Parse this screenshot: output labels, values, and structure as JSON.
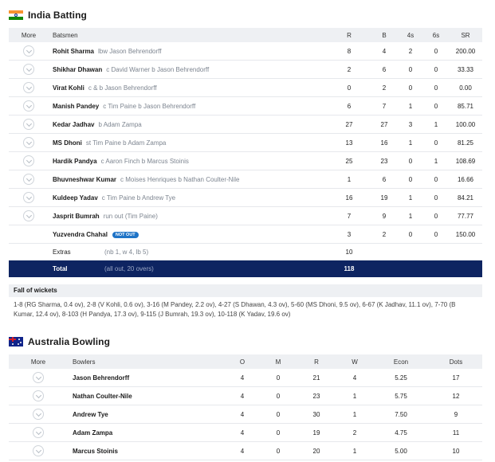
{
  "india": {
    "team_name": "India Batting",
    "headers": {
      "more": "More",
      "batsmen": "Batsmen",
      "r": "R",
      "b": "B",
      "fours": "4s",
      "sixes": "6s",
      "sr": "SR"
    },
    "rows": [
      {
        "name": "Rohit Sharma",
        "dismissal": "lbw Jason Behrendorff",
        "r": "8",
        "b": "4",
        "fours": "2",
        "sixes": "0",
        "sr": "200.00"
      },
      {
        "name": "Shikhar Dhawan",
        "dismissal": "c David Warner b Jason Behrendorff",
        "r": "2",
        "b": "6",
        "fours": "0",
        "sixes": "0",
        "sr": "33.33"
      },
      {
        "name": "Virat Kohli",
        "dismissal": "c & b Jason Behrendorff",
        "r": "0",
        "b": "2",
        "fours": "0",
        "sixes": "0",
        "sr": "0.00"
      },
      {
        "name": "Manish Pandey",
        "dismissal": "c Tim Paine b Jason Behrendorff",
        "r": "6",
        "b": "7",
        "fours": "1",
        "sixes": "0",
        "sr": "85.71"
      },
      {
        "name": "Kedar Jadhav",
        "dismissal": "b Adam Zampa",
        "r": "27",
        "b": "27",
        "fours": "3",
        "sixes": "1",
        "sr": "100.00"
      },
      {
        "name": "MS Dhoni",
        "dismissal": "st Tim Paine b Adam Zampa",
        "r": "13",
        "b": "16",
        "fours": "1",
        "sixes": "0",
        "sr": "81.25"
      },
      {
        "name": "Hardik Pandya",
        "dismissal": "c Aaron Finch b Marcus Stoinis",
        "r": "25",
        "b": "23",
        "fours": "0",
        "sixes": "1",
        "sr": "108.69"
      },
      {
        "name": "Bhuvneshwar Kumar",
        "dismissal": "c Moises Henriques b Nathan Coulter-Nile",
        "r": "1",
        "b": "6",
        "fours": "0",
        "sixes": "0",
        "sr": "16.66"
      },
      {
        "name": "Kuldeep Yadav",
        "dismissal": "c Tim Paine b Andrew Tye",
        "r": "16",
        "b": "19",
        "fours": "1",
        "sixes": "0",
        "sr": "84.21"
      },
      {
        "name": "Jasprit Bumrah",
        "dismissal": "run out (Tim Paine)",
        "r": "7",
        "b": "9",
        "fours": "1",
        "sixes": "0",
        "sr": "77.77"
      }
    ],
    "notout_row": {
      "name": "Yuzvendra Chahal",
      "badge": "NOT OUT",
      "r": "3",
      "b": "2",
      "fours": "0",
      "sixes": "0",
      "sr": "150.00"
    },
    "extras": {
      "label": "Extras",
      "detail": "(nb 1, w 4, lb 5)",
      "value": "10"
    },
    "total": {
      "label": "Total",
      "detail": "(all out, 20 overs)",
      "value": "118"
    },
    "colors": {
      "total_bg": "#0e2461",
      "badge_bg": "#1f74c7",
      "header_bg": "#eef0f3"
    }
  },
  "fall_of_wickets": {
    "title": "Fall of wickets",
    "text": "1-8 (RG Sharma, 0.4 ov), 2-8 (V Kohli, 0.6 ov), 3-16 (M Pandey, 2.2 ov), 4-27 (S Dhawan, 4.3 ov), 5-60 (MS Dhoni, 9.5 ov), 6-67 (K Jadhav, 11.1 ov), 7-70 (B Kumar, 12.4 ov), 8-103 (H Pandya, 17.3 ov), 9-115 (J Bumrah, 19.3 ov), 10-118 (K Yadav, 19.6 ov)"
  },
  "australia": {
    "team_name": "Australia Bowling",
    "headers": {
      "more": "More",
      "bowlers": "Bowlers",
      "o": "O",
      "m": "M",
      "r": "R",
      "w": "W",
      "econ": "Econ",
      "dots": "Dots"
    },
    "rows": [
      {
        "name": "Jason Behrendorff",
        "o": "4",
        "m": "0",
        "r": "21",
        "w": "4",
        "econ": "5.25",
        "dots": "17"
      },
      {
        "name": "Nathan Coulter-Nile",
        "o": "4",
        "m": "0",
        "r": "23",
        "w": "1",
        "econ": "5.75",
        "dots": "12"
      },
      {
        "name": "Andrew Tye",
        "o": "4",
        "m": "0",
        "r": "30",
        "w": "1",
        "econ": "7.50",
        "dots": "9"
      },
      {
        "name": "Adam Zampa",
        "o": "4",
        "m": "0",
        "r": "19",
        "w": "2",
        "econ": "4.75",
        "dots": "11"
      },
      {
        "name": "Marcus Stoinis",
        "o": "4",
        "m": "0",
        "r": "20",
        "w": "1",
        "econ": "5.00",
        "dots": "10"
      }
    ]
  },
  "icons": {
    "more": "chevron-down-icon",
    "india_flag": "india-flag-icon",
    "australia_flag": "australia-flag-icon"
  }
}
